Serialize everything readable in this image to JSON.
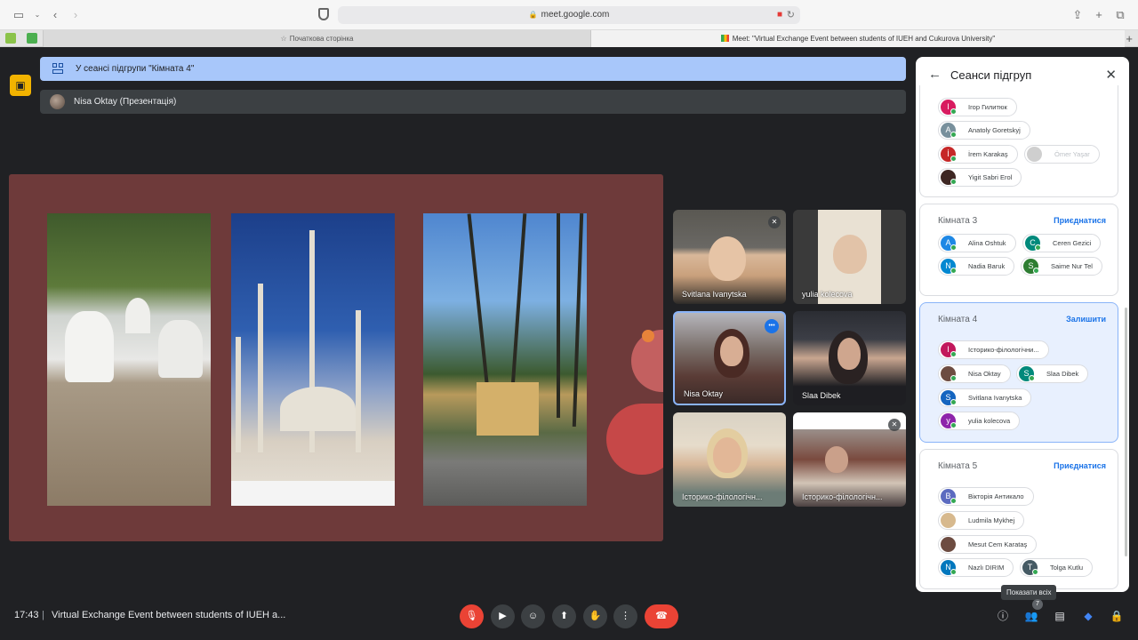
{
  "browser": {
    "address": "meet.google.com",
    "tabs": [
      {
        "label": "Початкова сторінка"
      },
      {
        "label": "Meet: \"Virtual Exchange Event between students of IUEH and Cukurova University\""
      }
    ]
  },
  "meet": {
    "banner": "У сеансі підгрупи \"Кімната 4\"",
    "presenter": "Nisa Oktay (Презентація)",
    "tiles": [
      {
        "name": "Svitlana Ivanytska"
      },
      {
        "name": "yulia kolecova"
      },
      {
        "name": "Nisa Oktay"
      },
      {
        "name": "Slaa Dibek"
      },
      {
        "name": "Історико-філологічн..."
      },
      {
        "name": "Історико-філологічн..."
      }
    ],
    "time": "17:43",
    "separator": "|",
    "meeting_title": "Virtual Exchange Event between students of IUEH a...",
    "tooltip": "Показати всіх",
    "people_count": "7"
  },
  "panel": {
    "title": "Сеанси підгруп",
    "rooms": [
      {
        "name": "",
        "action": "",
        "people": [
          {
            "initial": "I",
            "name": "Ігор Гилитюк",
            "color": "#d81b60"
          },
          {
            "initial": "A",
            "name": "Anatoly Goretskyj",
            "color": "#78909c"
          },
          {
            "initial": "İ",
            "name": "İrem Karakaş",
            "color": "#c62828"
          },
          {
            "initial": "",
            "name": "Ömer Yaşar",
            "color": "#bdbdbd"
          },
          {
            "initial": "",
            "name": "Yigit Sabri Erol",
            "color": "#4e342e"
          }
        ]
      },
      {
        "name": "Кімната 3",
        "action": "Приєднатися",
        "people": [
          {
            "initial": "A",
            "name": "Alina Oshtuk",
            "color": "#1e88e5"
          },
          {
            "initial": "C",
            "name": "Ceren Gezici",
            "color": "#00897b"
          },
          {
            "initial": "N",
            "name": "Nadia Baruk",
            "color": "#0288d1"
          },
          {
            "initial": "S",
            "name": "Saime Nur Tel",
            "color": "#2e7d32"
          }
        ]
      },
      {
        "name": "Кімната 4",
        "action": "Залишити",
        "people": [
          {
            "initial": "I",
            "name": "Історико-філологічни...",
            "color": "#c2185b"
          },
          {
            "initial": "",
            "name": "Nisa Oktay",
            "color": "#6d4c41"
          },
          {
            "initial": "S",
            "name": "Slaa Dibek",
            "color": "#00897b"
          },
          {
            "initial": "S",
            "name": "Svitlana Ivanytska",
            "color": "#1565c0"
          },
          {
            "initial": "y",
            "name": "yulia kolecova",
            "color": "#8e24aa"
          }
        ]
      },
      {
        "name": "Кімната 5",
        "action": "Приєднатися",
        "people": [
          {
            "initial": "B",
            "name": "Вікторія Антикало",
            "color": "#5c6bc0"
          },
          {
            "initial": "",
            "name": "Ludmila Mykhej",
            "color": "#d7b98e"
          },
          {
            "initial": "",
            "name": "Mesut Cem Karataş",
            "color": "#6d4c41"
          },
          {
            "initial": "N",
            "name": "Nazlı DIRIM",
            "color": "#0277bd"
          },
          {
            "initial": "T",
            "name": "Tolga Kutlu",
            "color": "#455a64"
          }
        ]
      }
    ]
  },
  "icons": {
    "sidebar": "sidebar-icon",
    "present": "present-icon",
    "people": "people-icon"
  }
}
